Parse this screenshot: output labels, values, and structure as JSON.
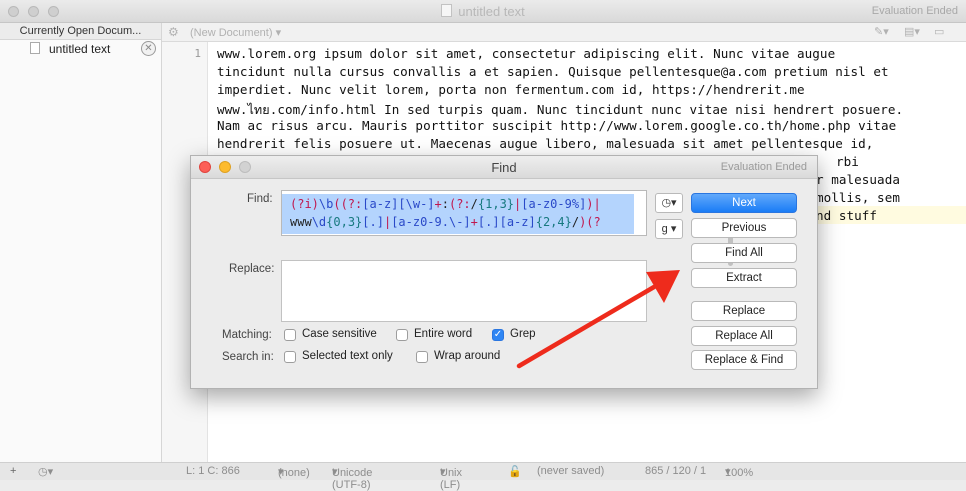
{
  "window": {
    "title": "untitled text",
    "eval_badge": "Evaluation Ended"
  },
  "sidebar": {
    "header": "Currently Open Docum...",
    "documents": [
      {
        "name": "untitled text"
      }
    ]
  },
  "nav": {
    "document_menu": "(New Document)"
  },
  "editor": {
    "line_number": "1",
    "lines": [
      "www.lorem.org ipsum dolor sit amet, consectetur adipiscing elit. Nunc vitae augue",
      "tincidunt nulla cursus convallis a et sapien. Quisque pellentesque@a.com pretium nisl et",
      "imperdiet. Nunc velit lorem, porta non fermentum.com id, https://hendrerit.me",
      "www.ไทย.com/info.html In sed turpis quam. Nunc tincidunt nunc vitae nisi hendrert posuere.",
      "Nam ac risus arcu. Mauris porttitor suscipit http://www.lorem.google.co.th/home.php vitae",
      "hendrerit felis posuere ut. Maecenas augue libero, malesuada sit amet pellentesque id,"
    ],
    "behind_dialog": [
      "rbi",
      "r malesuada",
      "mollis, sem",
      "nd stuff"
    ]
  },
  "status": {
    "position": "L: 1 C: 866",
    "language": "(none)",
    "encoding": "Unicode (UTF-8)",
    "line_endings": "Unix (LF)",
    "saved": "(never saved)",
    "counts": "865 / 120 / 1",
    "zoom": "100%"
  },
  "find_dialog": {
    "title": "Find",
    "eval_badge": "Evaluation Ended",
    "find_label": "Find:",
    "find_value": "(?i)\\b((?:[a-z][\\w-]+:(?:/{1,3}|[a-z0-9%])|www\\d{0,3}[.]|[a-z0-9.\\-]+[.][a-z]{2,4}/)(?",
    "replace_label": "Replace:",
    "replace_value": "",
    "grep_menu": "g",
    "matching_label": "Matching:",
    "search_in_label": "Search in:",
    "options": {
      "case_sensitive": {
        "label": "Case sensitive",
        "checked": false
      },
      "entire_word": {
        "label": "Entire word",
        "checked": false
      },
      "grep": {
        "label": "Grep",
        "checked": true
      },
      "selected_text_only": {
        "label": "Selected text only",
        "checked": false
      },
      "wrap_around": {
        "label": "Wrap around",
        "checked": false
      }
    },
    "buttons": {
      "next": "Next",
      "previous": "Previous",
      "find_all": "Find All",
      "extract": "Extract",
      "replace": "Replace",
      "replace_all": "Replace All",
      "replace_and_find": "Replace & Find"
    }
  },
  "annotation": {
    "arrow_color": "#ee2b1c"
  },
  "colors": {
    "accent": "#1a7cf6",
    "selection": "#b4d4fd"
  }
}
